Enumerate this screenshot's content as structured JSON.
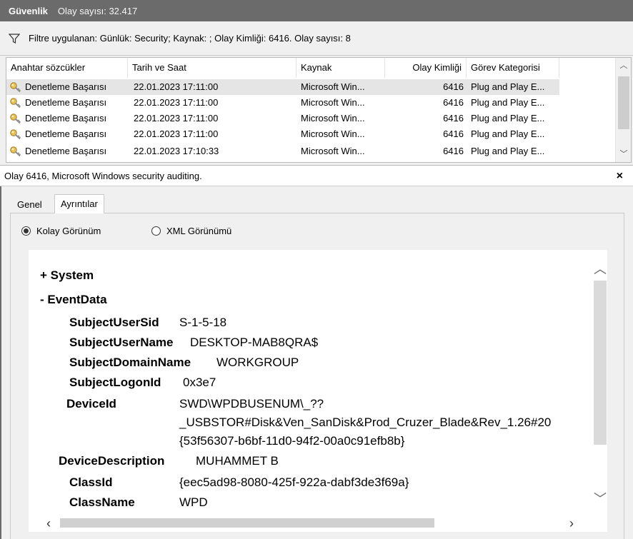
{
  "title": {
    "main": "Güvenlik",
    "count": "Olay sayısı: 32.417"
  },
  "filter": {
    "text": "Filtre uygulanan: Günlük: Security; Kaynak: ; Olay Kimliği: 6416. Olay sayısı: 8"
  },
  "columns": [
    "Anahtar sözcükler",
    "Tarih ve Saat",
    "Kaynak",
    "Olay Kimliği",
    "Görev Kategorisi"
  ],
  "rows": [
    {
      "keyword": "Denetleme Başarısı",
      "datetime": "22.01.2023 17:11:00",
      "source": "Microsoft Win...",
      "id": "6416",
      "category": "Plug and Play E..."
    },
    {
      "keyword": "Denetleme Başarısı",
      "datetime": "22.01.2023 17:11:00",
      "source": "Microsoft Win...",
      "id": "6416",
      "category": "Plug and Play E..."
    },
    {
      "keyword": "Denetleme Başarısı",
      "datetime": "22.01.2023 17:11:00",
      "source": "Microsoft Win...",
      "id": "6416",
      "category": "Plug and Play E..."
    },
    {
      "keyword": "Denetleme Başarısı",
      "datetime": "22.01.2023 17:11:00",
      "source": "Microsoft Win...",
      "id": "6416",
      "category": "Plug and Play E..."
    },
    {
      "keyword": "Denetleme Başarısı",
      "datetime": "22.01.2023 17:10:33",
      "source": "Microsoft Win...",
      "id": "6416",
      "category": "Plug and Play E..."
    }
  ],
  "detail": {
    "header": "Olay 6416, Microsoft Windows security auditing.",
    "close": "×"
  },
  "tabs": [
    "Genel",
    "Ayrıntılar"
  ],
  "views": {
    "friendly": "Kolay Görünüm",
    "xml": "XML Görünümü",
    "selected": "friendly"
  },
  "eventdata": {
    "system": "+ System",
    "eventdata": "-  EventData",
    "fields": [
      {
        "name": "SubjectUserSid",
        "value": "S-1-5-18"
      },
      {
        "name": "SubjectUserName",
        "value": "DESKTOP-MAB8QRA$"
      },
      {
        "name": "SubjectDomainName",
        "value": "WORKGROUP"
      },
      {
        "name": "SubjectLogonId",
        "value": "0x3e7"
      },
      {
        "name": "DeviceId",
        "value": "SWD\\WPDBUSENUM\\_??",
        "value2": "_USBSTOR#Disk&Ven_SanDisk&Prod_Cruzer_Blade&Rev_1.26#20",
        "value3": "{53f56307-b6bf-11d0-94f2-00a0c91efb8b}"
      },
      {
        "name": "DeviceDescription",
        "value": "MUHAMMET B"
      },
      {
        "name": "ClassId",
        "value": "{eec5ad98-8080-425f-922a-dabf3de3f69a}"
      },
      {
        "name": "ClassName",
        "value": "WPD"
      }
    ]
  },
  "icons": {
    "filter": "filter-icon",
    "key": "key-icon"
  }
}
